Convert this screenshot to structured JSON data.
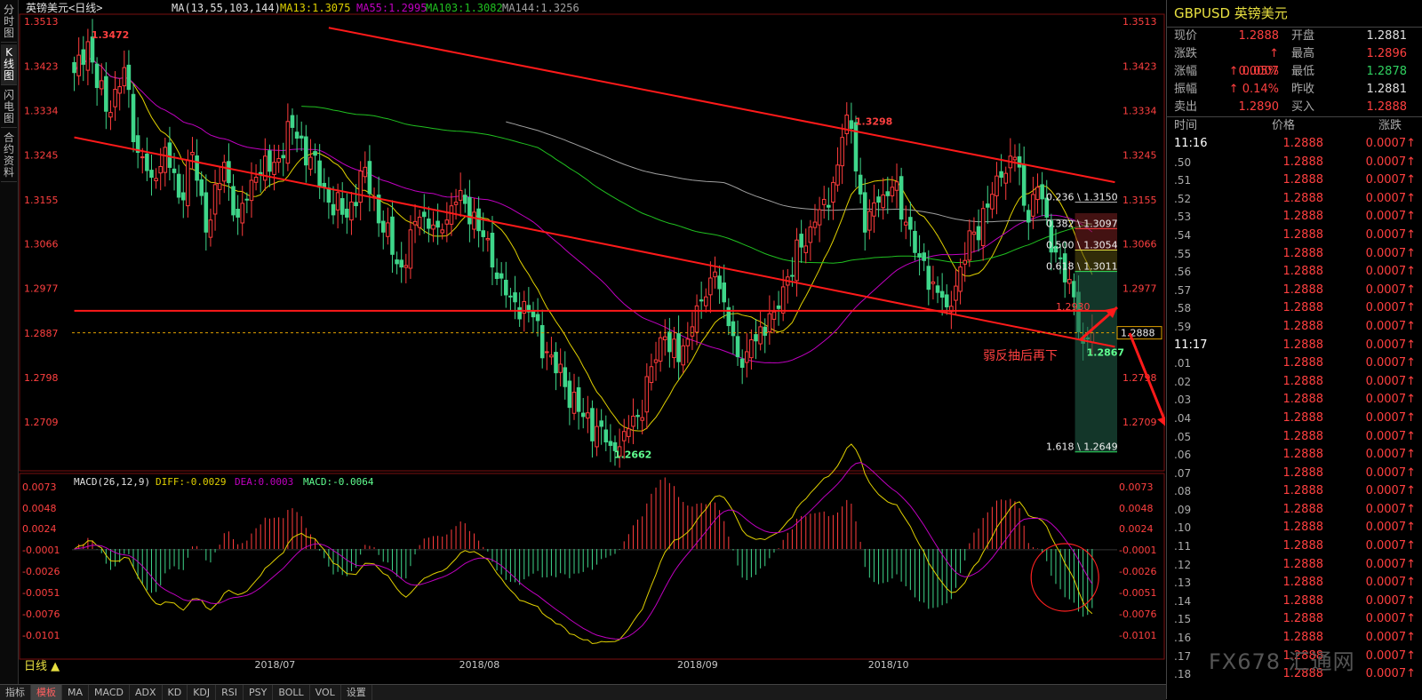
{
  "sidebar": {
    "tabs": [
      "分时图",
      "K线图",
      "闪电图",
      "合约资料"
    ],
    "active": 1
  },
  "header": {
    "symbol_name": "英镑美元",
    "period": "<日线>",
    "ma_params": "MA(13,55,103,144)",
    "ma13": "MA13:1.3075",
    "ma55": "MA55:1.2995",
    "ma103": "MA103:1.3082",
    "ma144": "MA144:1.3256"
  },
  "macd_header": {
    "params": "MACD(26,12,9)",
    "diff": "DIFF:-0.0029",
    "dea": "DEA:0.0003",
    "macd": "MACD:-0.0064"
  },
  "period_label": "日线",
  "bottom_tabs": [
    "指标",
    "模板",
    "MA",
    "MACD",
    "ADX",
    "KD",
    "KDJ",
    "RSI",
    "PSY",
    "BOLL",
    "VOL",
    "设置"
  ],
  "colors": {
    "up": "#ff3c3c",
    "down": "#3fd68a",
    "ma13": "#e0d000",
    "ma55": "#c000c0",
    "ma103": "#20c020",
    "ma144": "#a0a0a0",
    "trend": "#ff1a1a"
  },
  "chart_data": {
    "type": "candlestick",
    "price_axis": {
      "min": 1.262,
      "max": 1.352,
      "ticks": [
        "1.3513",
        "1.3423",
        "1.3334",
        "1.3245",
        "1.3155",
        "1.3066",
        "1.2977",
        "1.2887",
        "1.2798",
        "1.2709"
      ]
    },
    "macd_axis": {
      "min": -0.0125,
      "max": 0.0076,
      "ticks": [
        "0.0073",
        "0.0048",
        "0.0024",
        "-0.0001",
        "-0.0026",
        "-0.0051",
        "-0.0076",
        "-0.0101"
      ]
    },
    "date_labels": [
      {
        "label": "2018/07",
        "index": 44
      },
      {
        "label": "2018/08",
        "index": 89
      },
      {
        "label": "2018/09",
        "index": 137
      },
      {
        "label": "2018/10",
        "index": 179
      }
    ],
    "ohlc_anchors": [
      [
        0,
        1.341
      ],
      [
        1,
        1.3445
      ],
      [
        3,
        1.3472
      ],
      [
        5,
        1.338
      ],
      [
        8,
        1.333
      ],
      [
        11,
        1.342
      ],
      [
        14,
        1.325
      ],
      [
        17,
        1.32
      ],
      [
        20,
        1.326
      ],
      [
        23,
        1.316
      ],
      [
        26,
        1.325
      ],
      [
        29,
        1.309
      ],
      [
        33,
        1.323
      ],
      [
        36,
        1.312
      ],
      [
        40,
        1.32
      ],
      [
        44,
        1.323
      ],
      [
        48,
        1.33
      ],
      [
        52,
        1.324
      ],
      [
        56,
        1.315
      ],
      [
        60,
        1.312
      ],
      [
        64,
        1.322
      ],
      [
        68,
        1.309
      ],
      [
        72,
        1.302
      ],
      [
        76,
        1.312
      ],
      [
        80,
        1.31
      ],
      [
        84,
        1.315
      ],
      [
        88,
        1.313
      ],
      [
        92,
        1.302
      ],
      [
        96,
        1.296
      ],
      [
        100,
        1.293
      ],
      [
        104,
        1.285
      ],
      [
        108,
        1.278
      ],
      [
        112,
        1.272
      ],
      [
        115,
        1.27
      ],
      [
        118,
        1.2662
      ],
      [
        121,
        1.269
      ],
      [
        124,
        1.272
      ],
      [
        127,
        1.282
      ],
      [
        130,
        1.288
      ],
      [
        133,
        1.283
      ],
      [
        136,
        1.29
      ],
      [
        139,
        1.296
      ],
      [
        141,
        1.301
      ],
      [
        143,
        1.295
      ],
      [
        146,
        1.284
      ],
      [
        148,
        1.285
      ],
      [
        151,
        1.29
      ],
      [
        154,
        1.293
      ],
      [
        157,
        1.3
      ],
      [
        160,
        1.306
      ],
      [
        163,
        1.311
      ],
      [
        166,
        1.314
      ],
      [
        169,
        1.328
      ],
      [
        171,
        1.3298
      ],
      [
        174,
        1.309
      ],
      [
        177,
        1.315
      ],
      [
        180,
        1.318
      ],
      [
        183,
        1.311
      ],
      [
        186,
        1.304
      ],
      [
        189,
        1.299
      ],
      [
        192,
        1.294
      ],
      [
        195,
        1.302
      ],
      [
        198,
        1.309
      ],
      [
        201,
        1.314
      ],
      [
        204,
        1.32
      ],
      [
        207,
        1.324
      ],
      [
        210,
        1.311
      ],
      [
        212,
        1.318
      ],
      [
        214,
        1.312
      ],
      [
        216,
        1.305
      ],
      [
        218,
        1.299
      ],
      [
        220,
        1.296
      ],
      [
        222,
        1.2867
      ],
      [
        224,
        1.2888
      ]
    ],
    "labels": [
      {
        "text": "1.3472",
        "index": 3,
        "price": 1.3472,
        "color": "#ff4040",
        "pos": "above"
      },
      {
        "text": "1.3298",
        "index": 171,
        "price": 1.3298,
        "color": "#ff4040",
        "pos": "above"
      },
      {
        "text": "1.2662",
        "index": 118,
        "price": 1.2662,
        "color": "#60ff90",
        "pos": "below"
      },
      {
        "text": "1.2867",
        "index": 222,
        "price": 1.2867,
        "color": "#60ff90",
        "pos": "below"
      }
    ],
    "fibonacci": [
      {
        "label": "0.236 \\ 1.3150",
        "price": 1.315
      },
      {
        "label": "0.382 \\ 1.3097",
        "price": 1.3097
      },
      {
        "label": "0.500 \\ 1.3054",
        "price": 1.3054
      },
      {
        "label": "0.618 \\ 1.3011",
        "price": 1.3011
      },
      {
        "label": "1.618 \\ 1.2649",
        "price": 1.2649
      }
    ],
    "fib_extra_label": "1.2930",
    "current_price": "1.2888",
    "annotation": "弱反抽后再下",
    "trendlines": [
      {
        "from": [
          56,
          1.35
        ],
        "to": [
          229,
          1.319
        ]
      },
      {
        "from": [
          0,
          1.328
        ],
        "to": [
          229,
          1.286
        ]
      },
      {
        "from": [
          0,
          1.2932
        ],
        "to": [
          229,
          1.2932
        ]
      }
    ],
    "circle_center_index": 218
  },
  "quote": {
    "title": "GBPUSD 英镑美元",
    "rows": [
      {
        "l1": "现价",
        "v1": "1.2888",
        "c1": "red",
        "l2": "开盘",
        "v2": "1.2881",
        "c2": "white"
      },
      {
        "l1": "涨跌",
        "v1": "↑ 0.0007",
        "c1": "red",
        "l2": "最高",
        "v2": "1.2896",
        "c2": "red"
      },
      {
        "l1": "涨幅",
        "v1": "↑ 0.05%",
        "c1": "red",
        "l2": "最低",
        "v2": "1.2878",
        "c2": "green"
      },
      {
        "l1": "振幅",
        "v1": "↑ 0.14%",
        "c1": "red",
        "l2": "昨收",
        "v2": "1.2881",
        "c2": "white"
      },
      {
        "l1": "卖出",
        "v1": "1.2890",
        "c1": "red",
        "l2": "买入",
        "v2": "1.2888",
        "c2": "red"
      }
    ],
    "tick_header": {
      "time": "时间",
      "price": "价格",
      "change": "涨跌"
    },
    "ticks": [
      {
        "t": "11:16",
        "p": "1.2888",
        "c": "0.0007↑"
      },
      {
        "t": ".50",
        "p": "1.2888",
        "c": "0.0007↑"
      },
      {
        "t": ".51",
        "p": "1.2888",
        "c": "0.0007↑"
      },
      {
        "t": ".52",
        "p": "1.2888",
        "c": "0.0007↑"
      },
      {
        "t": ".53",
        "p": "1.2888",
        "c": "0.0007↑"
      },
      {
        "t": ".54",
        "p": "1.2888",
        "c": "0.0007↑"
      },
      {
        "t": ".55",
        "p": "1.2888",
        "c": "0.0007↑"
      },
      {
        "t": ".56",
        "p": "1.2888",
        "c": "0.0007↑"
      },
      {
        "t": ".57",
        "p": "1.2888",
        "c": "0.0007↑"
      },
      {
        "t": ".58",
        "p": "1.2888",
        "c": "0.0007↑"
      },
      {
        "t": ".59",
        "p": "1.2888",
        "c": "0.0007↑"
      },
      {
        "t": "11:17",
        "p": "1.2888",
        "c": "0.0007↑"
      },
      {
        "t": ".01",
        "p": "1.2888",
        "c": "0.0007↑"
      },
      {
        "t": ".02",
        "p": "1.2888",
        "c": "0.0007↑"
      },
      {
        "t": ".03",
        "p": "1.2888",
        "c": "0.0007↑"
      },
      {
        "t": ".04",
        "p": "1.2888",
        "c": "0.0007↑"
      },
      {
        "t": ".05",
        "p": "1.2888",
        "c": "0.0007↑"
      },
      {
        "t": ".06",
        "p": "1.2888",
        "c": "0.0007↑"
      },
      {
        "t": ".07",
        "p": "1.2888",
        "c": "0.0007↑"
      },
      {
        "t": ".08",
        "p": "1.2888",
        "c": "0.0007↑"
      },
      {
        "t": ".09",
        "p": "1.2888",
        "c": "0.0007↑"
      },
      {
        "t": ".10",
        "p": "1.2888",
        "c": "0.0007↑"
      },
      {
        "t": ".11",
        "p": "1.2888",
        "c": "0.0007↑"
      },
      {
        "t": ".12",
        "p": "1.2888",
        "c": "0.0007↑"
      },
      {
        "t": ".13",
        "p": "1.2888",
        "c": "0.0007↑"
      },
      {
        "t": ".14",
        "p": "1.2888",
        "c": "0.0007↑"
      },
      {
        "t": ".15",
        "p": "1.2888",
        "c": "0.0007↑"
      },
      {
        "t": ".16",
        "p": "1.2888",
        "c": "0.0007↑"
      },
      {
        "t": ".17",
        "p": "1.2888",
        "c": "0.0007↑"
      },
      {
        "t": ".18",
        "p": "1.2888",
        "c": "0.0007↑"
      }
    ]
  },
  "watermark": "FX678 汇通网"
}
